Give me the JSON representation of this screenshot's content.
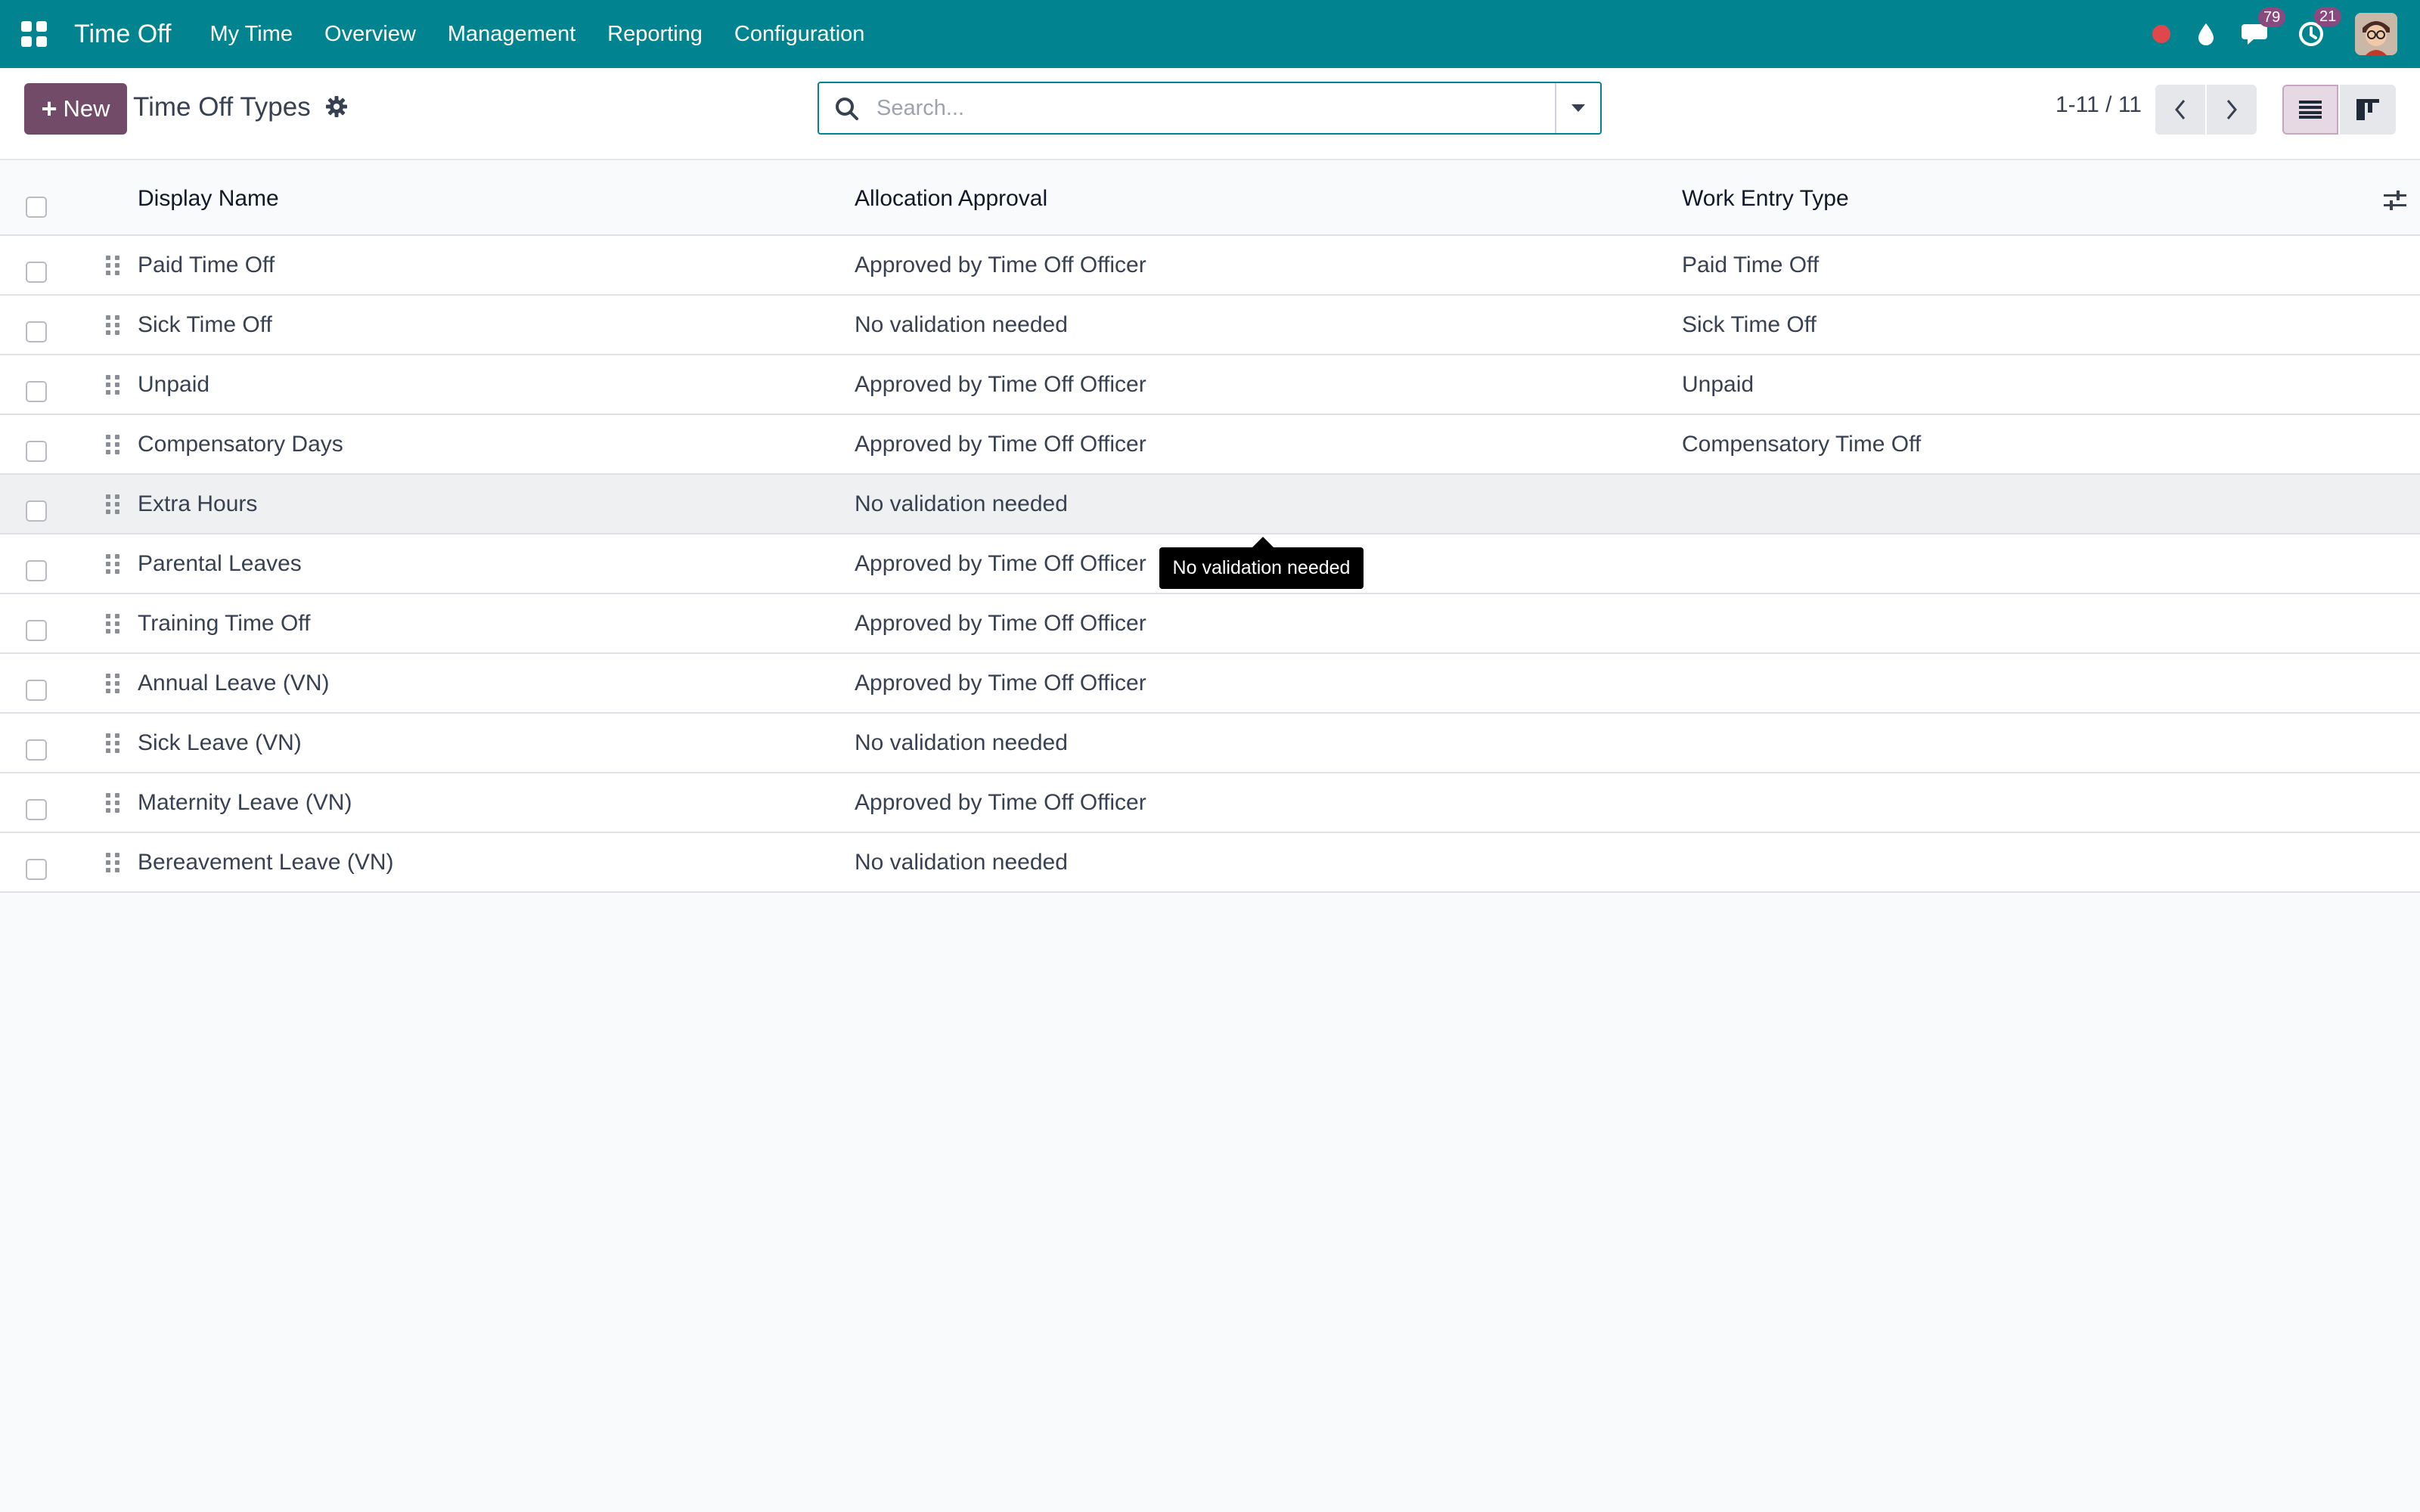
{
  "navbar": {
    "app_title": "Time Off",
    "menu": [
      "My Time",
      "Overview",
      "Management",
      "Reporting",
      "Configuration"
    ],
    "messages_count": "79",
    "activities_count": "21",
    "icons": [
      "apps-icon",
      "record-dot-icon",
      "droplet-icon",
      "chat-icon",
      "clock-icon",
      "avatar"
    ]
  },
  "control_panel": {
    "new_label": "New",
    "breadcrumb": "Time Off Types",
    "search_placeholder": "Search...",
    "pager_value": "1-11 / 11"
  },
  "table": {
    "columns": [
      "Display Name",
      "Allocation Approval",
      "Work Entry Type"
    ],
    "rows": [
      {
        "name": "Paid Time Off",
        "allocation": "Approved by Time Off Officer",
        "work_entry": "Paid Time Off"
      },
      {
        "name": "Sick Time Off",
        "allocation": "No validation needed",
        "work_entry": "Sick Time Off"
      },
      {
        "name": "Unpaid",
        "allocation": "Approved by Time Off Officer",
        "work_entry": "Unpaid"
      },
      {
        "name": "Compensatory Days",
        "allocation": "Approved by Time Off Officer",
        "work_entry": "Compensatory Time Off"
      },
      {
        "name": "Extra Hours",
        "allocation": "No validation needed",
        "work_entry": ""
      },
      {
        "name": "Parental Leaves",
        "allocation": "Approved by Time Off Officer",
        "work_entry": ""
      },
      {
        "name": "Training Time Off",
        "allocation": "Approved by Time Off Officer",
        "work_entry": ""
      },
      {
        "name": "Annual Leave (VN)",
        "allocation": "Approved by Time Off Officer",
        "work_entry": ""
      },
      {
        "name": "Sick Leave (VN)",
        "allocation": "No validation needed",
        "work_entry": ""
      },
      {
        "name": "Maternity Leave (VN)",
        "allocation": "Approved by Time Off Officer",
        "work_entry": ""
      },
      {
        "name": "Bereavement Leave (VN)",
        "allocation": "No validation needed",
        "work_entry": ""
      }
    ]
  },
  "tooltip": {
    "text": "No validation needed"
  },
  "colors": {
    "navbar": "#01848f",
    "primary_button": "#714b67",
    "badge": "#8b4a7f",
    "record_dot": "#e0474c"
  }
}
